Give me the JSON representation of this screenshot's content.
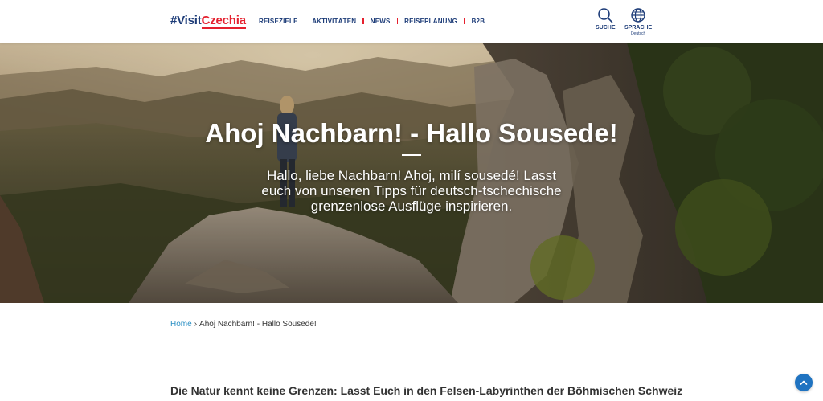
{
  "header": {
    "logo_hash": "#Visit",
    "logo_name": "Czechia",
    "nav": [
      {
        "label": "REISEZIELE"
      },
      {
        "label": "AKTIVITÄTEN"
      },
      {
        "label": "NEWS"
      },
      {
        "label": "REISEPLANUNG"
      },
      {
        "label": "B2B"
      }
    ],
    "search": {
      "label": "SUCHE",
      "icon": "search-icon"
    },
    "language": {
      "label": "SPRACHE",
      "current": "Deutsch",
      "icon": "globe-icon"
    }
  },
  "hero": {
    "title": "Ahoj Nachbarn! - Hallo Sousede!",
    "subtitle": "Hallo, liebe Nachbarn! Ahoj, milí sousedé! Lasst euch von unseren Tipps für deutsch-tschechische grenzenlose Ausflüge inspirieren."
  },
  "breadcrumb": {
    "home": "Home",
    "separator": "›",
    "current": "Ahoj Nachbarn! - Hallo Sousede!"
  },
  "intro": {
    "text": "Die Natur kennt keine Grenzen: Lasst Euch in den Felsen-Labyrinthen der Böhmischen Schweiz"
  },
  "scroll_top": {
    "icon": "chevron-up-icon"
  },
  "colors": {
    "brand_navy": "#1d3c78",
    "brand_red": "#e5202e",
    "link_blue": "#2a8fc4",
    "button_blue": "#1f73c1"
  }
}
